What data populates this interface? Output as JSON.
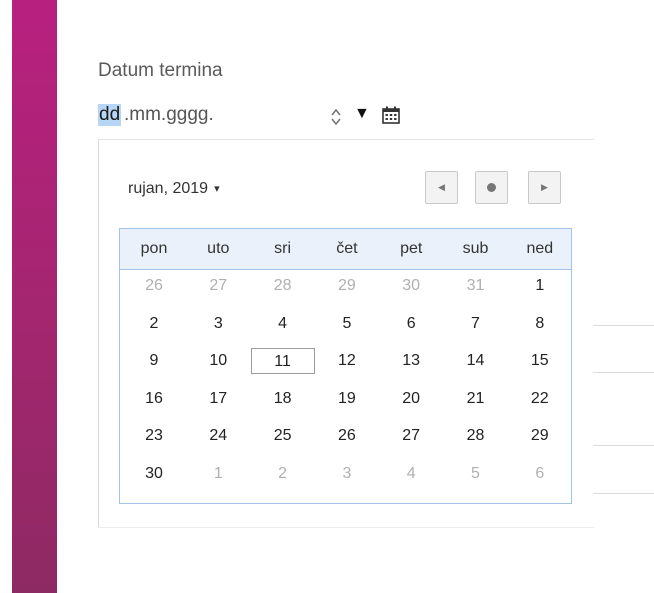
{
  "field": {
    "label": "Datum termina",
    "segment_day": "dd",
    "segment_rest": ".mm.gggg.",
    "spinner_icon": "spinner-icon",
    "dropdown_icon": "triangle-down-icon",
    "calendar_icon": "calendar-icon"
  },
  "calendar": {
    "month_label": "rujan, 2019",
    "month_caret": "▾",
    "nav": {
      "prev_glyph": "◀",
      "next_glyph": "▶",
      "today_icon": "dot-icon"
    },
    "weekdays": [
      "pon",
      "uto",
      "sri",
      "čet",
      "pet",
      "sub",
      "ned"
    ],
    "weeks": [
      [
        {
          "d": "26",
          "m": true
        },
        {
          "d": "27",
          "m": true
        },
        {
          "d": "28",
          "m": true
        },
        {
          "d": "29",
          "m": true
        },
        {
          "d": "30",
          "m": true
        },
        {
          "d": "31",
          "m": true
        },
        {
          "d": "1",
          "m": false
        }
      ],
      [
        {
          "d": "2",
          "m": false
        },
        {
          "d": "3",
          "m": false
        },
        {
          "d": "4",
          "m": false
        },
        {
          "d": "5",
          "m": false
        },
        {
          "d": "6",
          "m": false
        },
        {
          "d": "7",
          "m": false
        },
        {
          "d": "8",
          "m": false
        }
      ],
      [
        {
          "d": "9",
          "m": false
        },
        {
          "d": "10",
          "m": false
        },
        {
          "d": "11",
          "m": false,
          "today": true
        },
        {
          "d": "12",
          "m": false
        },
        {
          "d": "13",
          "m": false
        },
        {
          "d": "14",
          "m": false
        },
        {
          "d": "15",
          "m": false
        }
      ],
      [
        {
          "d": "16",
          "m": false
        },
        {
          "d": "17",
          "m": false
        },
        {
          "d": "18",
          "m": false
        },
        {
          "d": "19",
          "m": false
        },
        {
          "d": "20",
          "m": false
        },
        {
          "d": "21",
          "m": false
        },
        {
          "d": "22",
          "m": false
        }
      ],
      [
        {
          "d": "23",
          "m": false
        },
        {
          "d": "24",
          "m": false
        },
        {
          "d": "25",
          "m": false
        },
        {
          "d": "26",
          "m": false
        },
        {
          "d": "27",
          "m": false
        },
        {
          "d": "28",
          "m": false
        },
        {
          "d": "29",
          "m": false
        }
      ],
      [
        {
          "d": "30",
          "m": false
        },
        {
          "d": "1",
          "m": true
        },
        {
          "d": "2",
          "m": true
        },
        {
          "d": "3",
          "m": true
        },
        {
          "d": "4",
          "m": true
        },
        {
          "d": "5",
          "m": true
        },
        {
          "d": "6",
          "m": true
        }
      ]
    ]
  },
  "colors": {
    "accent": "#b8207f",
    "grid_border": "#a5c3e8",
    "grid_header_bg": "#eaf1fb",
    "selection": "#b7d6f5"
  }
}
